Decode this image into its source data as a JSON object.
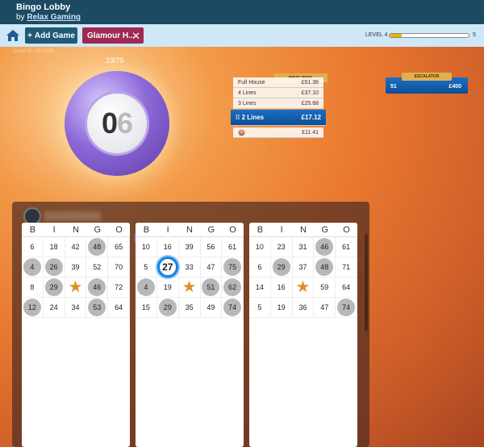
{
  "header": {
    "title": "Bingo Lobby",
    "by_prefix": "by ",
    "by_link": "Relax Gaming"
  },
  "toolbar": {
    "home_icon": "home-icon",
    "add_game_label": "Add Game",
    "game_tab_label": "Glamour H...",
    "level_label": "LEVEL 4",
    "level_max": "5",
    "level_progress": 0.15
  },
  "game": {
    "game_id": "Game ID: 5071235",
    "ball_count": "23/75",
    "current_ball": "06",
    "current_ball_primary": "0",
    "current_ball_secondary": "6"
  },
  "prize_pool": {
    "title": "PRIZE POOL",
    "rows": [
      {
        "label": "Full House",
        "value": "£51.36"
      },
      {
        "label": "4 Lines",
        "value": "£37.10"
      },
      {
        "label": "3 Lines",
        "value": "£25.68"
      },
      {
        "label": "2 Lines",
        "value": "£17.12",
        "active": true
      },
      {
        "label": "",
        "value": "£11.41"
      }
    ]
  },
  "escalator": {
    "title": "ESCALATOR",
    "left": "51",
    "right": "£400"
  },
  "players": [
    {
      "avatar": "dark"
    },
    {
      "avatar": "face",
      "ball": "069"
    },
    {
      "avatar": "face"
    },
    {
      "avatar": "face"
    },
    {
      "avatar": "face"
    }
  ],
  "cards": [
    {
      "header": [
        "B",
        "I",
        "N",
        "G",
        "O"
      ],
      "rows": [
        [
          {
            "n": "6"
          },
          {
            "n": "18"
          },
          {
            "n": "42"
          },
          {
            "n": "48",
            "m": true
          },
          {
            "n": "65"
          }
        ],
        [
          {
            "n": "4",
            "m": true
          },
          {
            "n": "26",
            "m": true
          },
          {
            "n": "39"
          },
          {
            "n": "52"
          },
          {
            "n": "70"
          }
        ],
        [
          {
            "n": "8"
          },
          {
            "n": "29",
            "m": true
          },
          {
            "n": "★",
            "s": true
          },
          {
            "n": "46",
            "m": true
          },
          {
            "n": "72"
          }
        ],
        [
          {
            "n": "12",
            "m": true
          },
          {
            "n": "24"
          },
          {
            "n": "34"
          },
          {
            "n": "53",
            "m": true
          },
          {
            "n": "64"
          }
        ]
      ]
    },
    {
      "header": [
        "B",
        "I",
        "N",
        "G",
        "O"
      ],
      "rows": [
        [
          {
            "n": "10"
          },
          {
            "n": "16"
          },
          {
            "n": "39"
          },
          {
            "n": "56"
          },
          {
            "n": "61"
          }
        ],
        [
          {
            "n": "5"
          },
          {
            "n": "27",
            "c": true
          },
          {
            "n": "33"
          },
          {
            "n": "47"
          },
          {
            "n": "75",
            "m": true
          }
        ],
        [
          {
            "n": "4",
            "m": true
          },
          {
            "n": "19"
          },
          {
            "n": "★",
            "s": true
          },
          {
            "n": "51",
            "m": true
          },
          {
            "n": "62",
            "m": true
          }
        ],
        [
          {
            "n": "15"
          },
          {
            "n": "29",
            "m": true
          },
          {
            "n": "35"
          },
          {
            "n": "49"
          },
          {
            "n": "74",
            "m": true
          }
        ]
      ]
    },
    {
      "header": [
        "B",
        "I",
        "N",
        "G",
        "O"
      ],
      "rows": [
        [
          {
            "n": "10"
          },
          {
            "n": "23"
          },
          {
            "n": "31"
          },
          {
            "n": "46",
            "m": true
          },
          {
            "n": "61"
          }
        ],
        [
          {
            "n": "6"
          },
          {
            "n": "29",
            "m": true
          },
          {
            "n": "37"
          },
          {
            "n": "48",
            "m": true
          },
          {
            "n": "71"
          }
        ],
        [
          {
            "n": "14"
          },
          {
            "n": "16"
          },
          {
            "n": "★",
            "s": true
          },
          {
            "n": "59"
          },
          {
            "n": "64"
          }
        ],
        [
          {
            "n": "5"
          },
          {
            "n": "19"
          },
          {
            "n": "36"
          },
          {
            "n": "47"
          },
          {
            "n": "74",
            "m": true
          }
        ]
      ]
    }
  ]
}
